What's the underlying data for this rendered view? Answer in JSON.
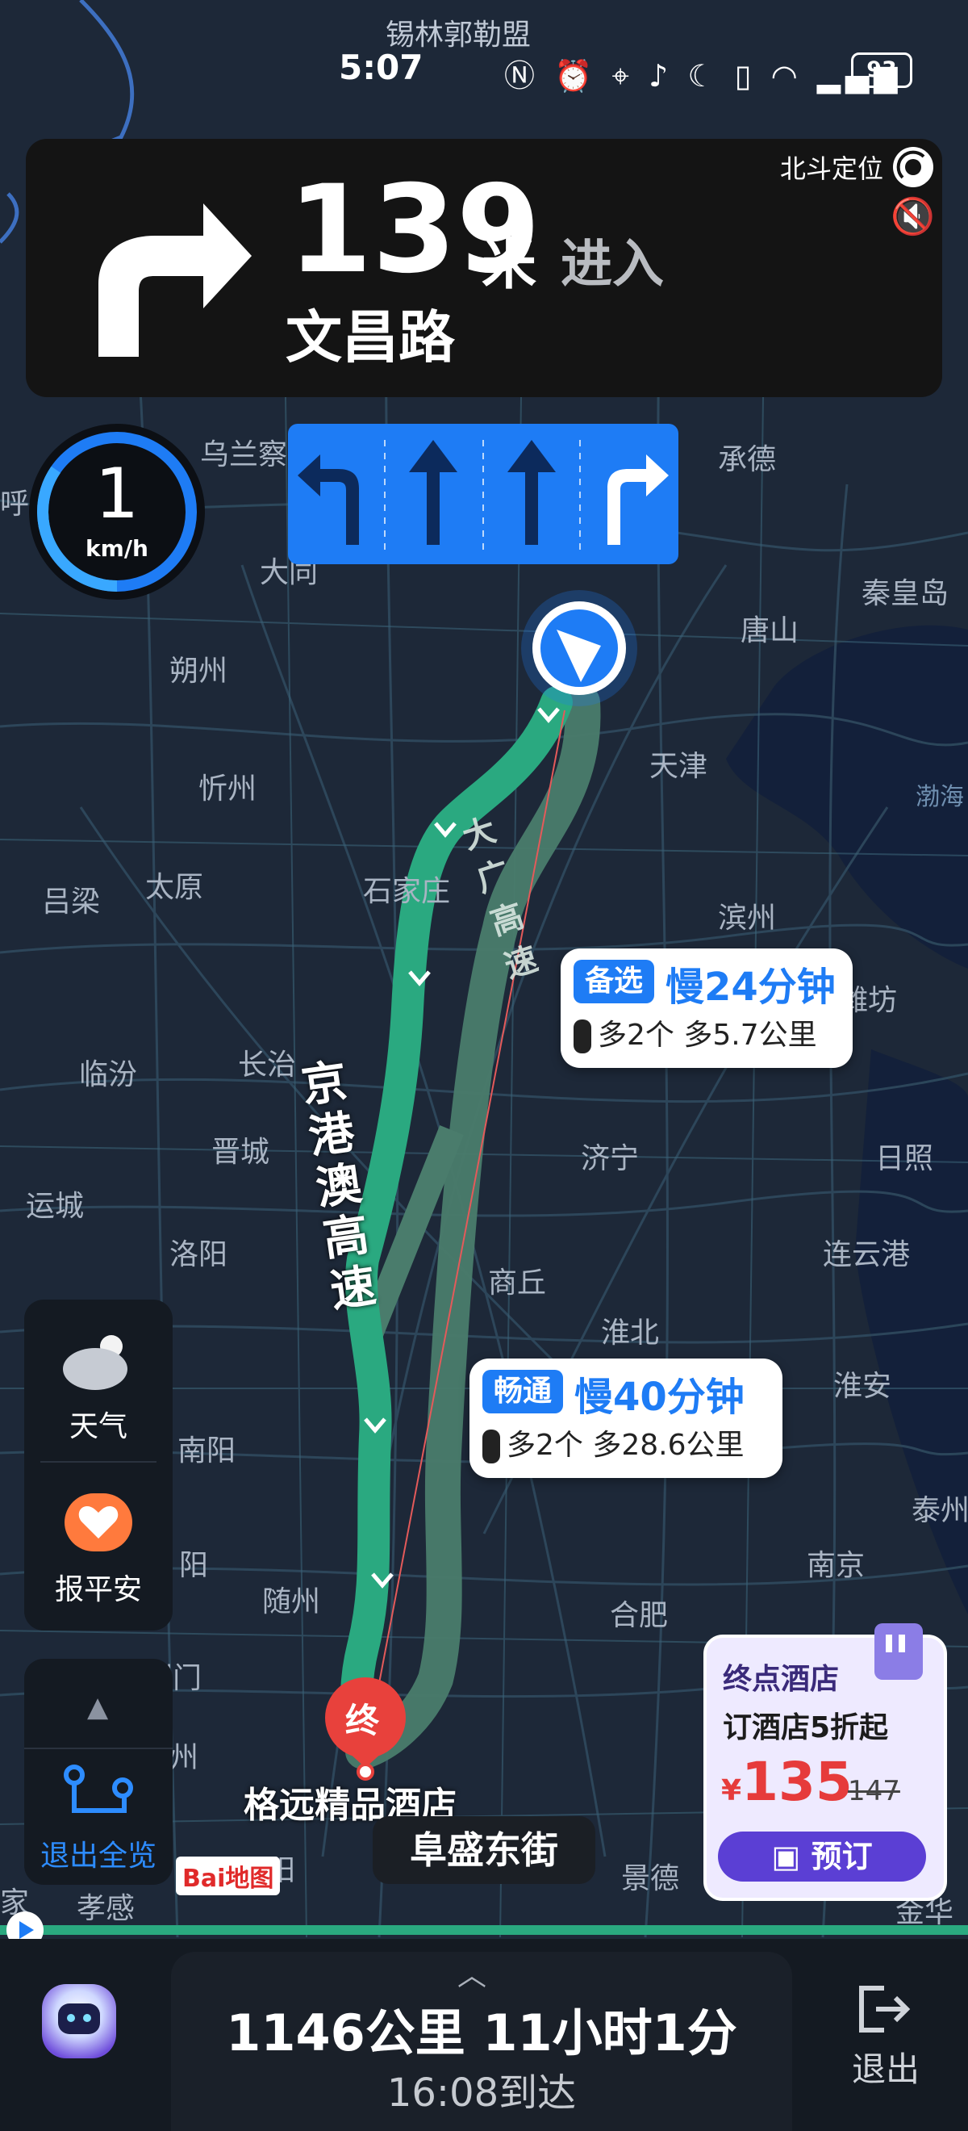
{
  "status_bar": {
    "time": "5:07",
    "battery": "93",
    "icons": [
      "nfc-icon",
      "alarm-icon",
      "location-icon",
      "mic-icon",
      "moon-icon",
      "vibrate-icon",
      "wifi-icon",
      "5g-signal-icon"
    ]
  },
  "nav": {
    "distance": "139",
    "distance_unit": "米",
    "action": "进入",
    "road": "文昌路",
    "positioning": "北斗定位"
  },
  "speed": {
    "value": "1",
    "unit": "km/h"
  },
  "map": {
    "cities": [
      "锡林郭勒盟",
      "呼",
      "乌兰察",
      "承德",
      "大同",
      "秦皇岛",
      "唐山",
      "朔州",
      "天津",
      "忻州",
      "渤海",
      "石家庄",
      "太原",
      "吕梁",
      "滨州",
      "潍坊",
      "临汾",
      "长治",
      "晋城",
      "济宁",
      "日照",
      "运城",
      "洛阳",
      "商丘",
      "连云港",
      "淮北",
      "淮安",
      "南阳",
      "泰州",
      "阳",
      "随州",
      "合肥",
      "南京",
      "荆门",
      "州",
      "阳",
      "景德",
      "金华",
      "家",
      "孝感"
    ],
    "roads": {
      "primary": "京港澳高速",
      "alt": "大广高速"
    },
    "destination": "格远精品酒店",
    "street": "阜盛东街",
    "logo": "Bai地图"
  },
  "routes": [
    {
      "tag": "备选",
      "delta_time": "慢24分钟",
      "detail": "多2个 多5.7公里"
    },
    {
      "tag": "畅通",
      "delta_time": "慢40分钟",
      "detail": "多2个 多28.6公里"
    }
  ],
  "side": {
    "weather": "天气",
    "safe": "报平安",
    "overview": "退出全览"
  },
  "hotel": {
    "title": "终点酒店",
    "promo": "订酒店5折起",
    "currency": "¥",
    "price": "135",
    "old_price": "147",
    "book": "预订"
  },
  "end_marker": "终",
  "bottom": {
    "remaining": "1146公里 11小时1分",
    "arrival": "16:08到达",
    "exit": "退出"
  },
  "colors": {
    "route_green": "#2aa980",
    "route_alt": "#4a7c6c",
    "accent_blue": "#1e7cf5",
    "hotel_purple": "#5b3fd4",
    "price_red": "#e63b3b"
  }
}
